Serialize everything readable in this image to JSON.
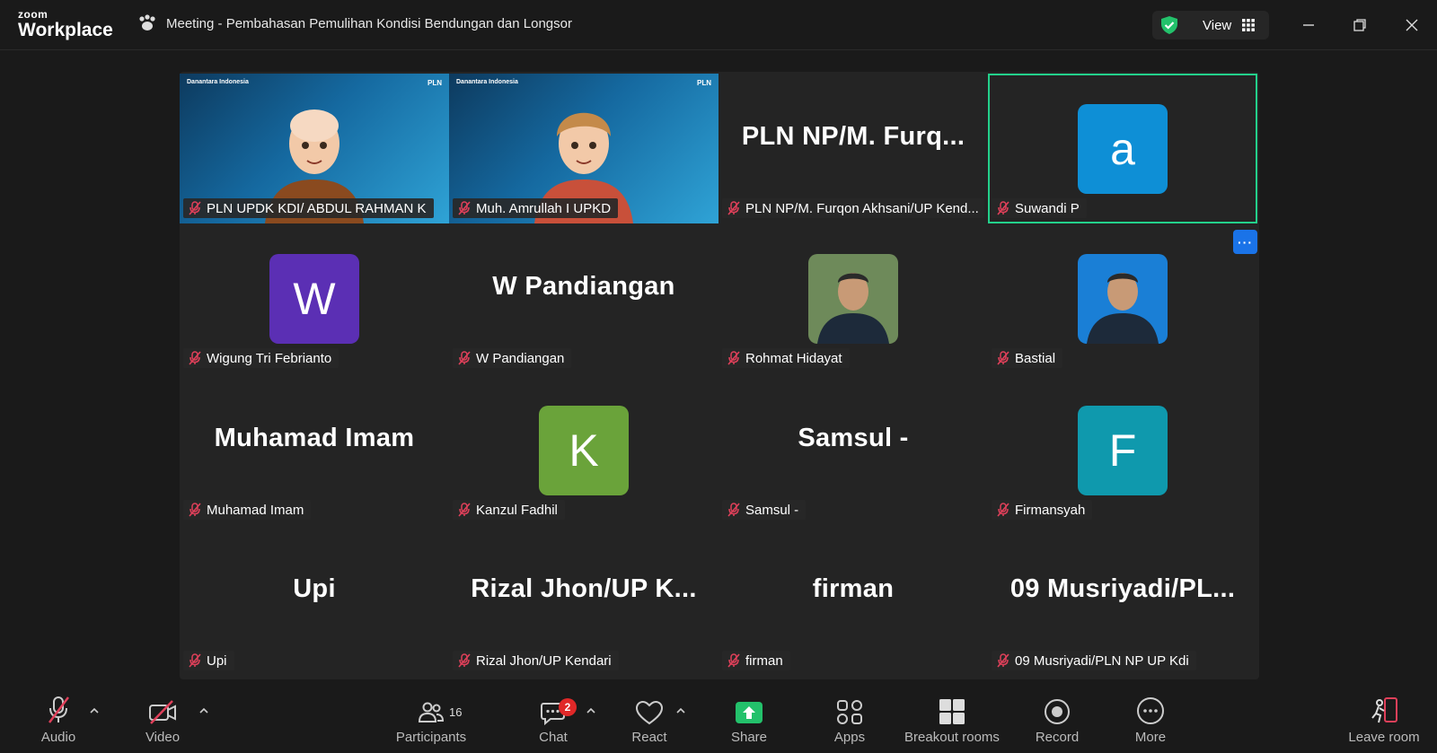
{
  "app": {
    "brand_top": "zoom",
    "brand_bottom": "Workplace",
    "meeting_title": "Meeting - Pembahasan Pemulihan Kondisi Bendungan dan Longsor",
    "view_label": "View"
  },
  "participants": [
    {
      "name": "PLN UPDK KDI/ ABDUL RAHMAN K",
      "type": "video",
      "logo_left": "Danantara Indonesia",
      "logo_right": "PLN"
    },
    {
      "name": "Muh. Amrullah I UPKD",
      "type": "video",
      "logo_left": "Danantara Indonesia",
      "logo_right": "PLN"
    },
    {
      "name": "PLN NP/M. Furqon Akhsani/UP Kend...",
      "type": "text",
      "display": "PLN NP/M. Furq..."
    },
    {
      "name": "Suwandi P",
      "type": "avatar",
      "initial": "a",
      "color": "#0e8fd6",
      "active": true
    },
    {
      "name": "Wigung Tri Febrianto",
      "type": "avatar",
      "initial": "W",
      "color": "#5b2fb4"
    },
    {
      "name": "W Pandiangan",
      "type": "text",
      "display": "W Pandiangan"
    },
    {
      "name": "Rohmat Hidayat",
      "type": "photo",
      "color": "#6e8a5a"
    },
    {
      "name": "Bastial",
      "type": "photo",
      "color": "#1a7fd6"
    },
    {
      "name": "Muhamad Imam",
      "type": "text",
      "display": "Muhamad Imam"
    },
    {
      "name": "Kanzul Fadhil",
      "type": "avatar",
      "initial": "K",
      "color": "#6aa33a"
    },
    {
      "name": "Samsul -",
      "type": "text",
      "display": "Samsul -"
    },
    {
      "name": "Firmansyah",
      "type": "avatar",
      "initial": "F",
      "color": "#0f99ad"
    },
    {
      "name": "Upi",
      "type": "text",
      "display": "Upi"
    },
    {
      "name": "Rizal Jhon/UP Kendari",
      "type": "text",
      "display": "Rizal Jhon/UP K..."
    },
    {
      "name": "firman",
      "type": "text",
      "display": "firman"
    },
    {
      "name": "09 Musriyadi/PLN NP UP Kdi",
      "type": "text",
      "display": "09  Musriyadi/PL..."
    }
  ],
  "toolbar": {
    "audio": "Audio",
    "video": "Video",
    "participants": "Participants",
    "participants_count": "16",
    "chat": "Chat",
    "chat_badge": "2",
    "react": "React",
    "share": "Share",
    "apps": "Apps",
    "breakout": "Breakout rooms",
    "record": "Record",
    "more": "More",
    "leave": "Leave room"
  },
  "colors": {
    "active_border": "#23d18b",
    "share_green": "#23c16b",
    "mute_red": "#e0405a",
    "badge_red": "#e02828"
  },
  "icons": [
    "paw-icon",
    "shield-check-icon",
    "grid-icon",
    "minimize-icon",
    "restore-icon",
    "close-icon",
    "mic-muted-icon",
    "video-off-icon",
    "participants-icon",
    "chat-icon",
    "heart-icon",
    "share-icon",
    "apps-icon",
    "breakout-icon",
    "record-icon",
    "more-icon",
    "leave-icon"
  ]
}
